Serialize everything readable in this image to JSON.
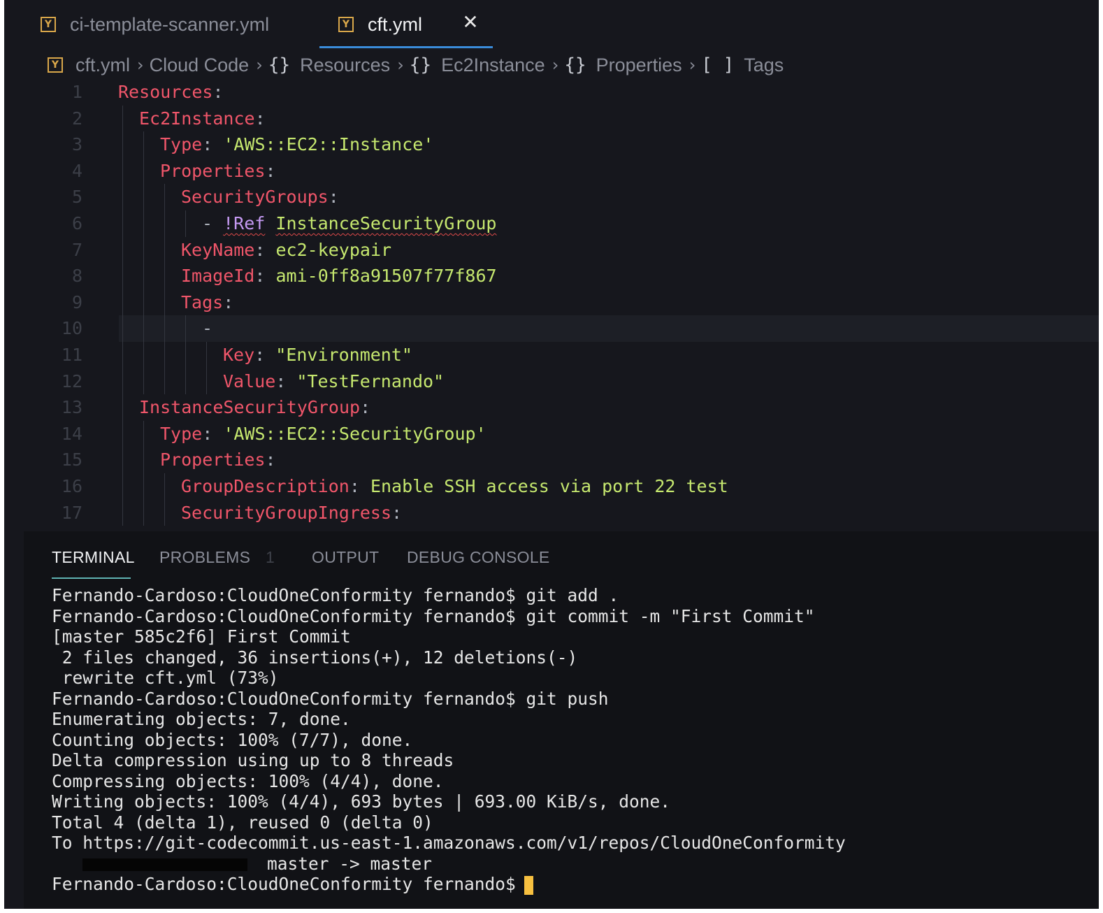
{
  "tabs": [
    {
      "icon": "yaml-file-icon",
      "label": "ci-template-scanner.yml",
      "active": false
    },
    {
      "icon": "yaml-file-icon",
      "label": "cft.yml",
      "active": true
    }
  ],
  "breadcrumb": {
    "items": [
      {
        "icon": "yaml-file-icon",
        "label": "cft.yml"
      },
      {
        "label": "Cloud Code"
      },
      {
        "icon": "{}",
        "label": "Resources"
      },
      {
        "icon": "{}",
        "label": "Ec2Instance"
      },
      {
        "icon": "{}",
        "label": "Properties"
      },
      {
        "icon": "[ ]",
        "label": "Tags"
      }
    ]
  },
  "editor": {
    "current_line": 10,
    "lines": [
      {
        "n": "1",
        "indent": 0,
        "key": "Resources",
        "colon": ":",
        "value": ""
      },
      {
        "n": "2",
        "indent": 1,
        "key": "Ec2Instance",
        "colon": ":",
        "value": ""
      },
      {
        "n": "3",
        "indent": 2,
        "key": "Type",
        "colon": ":",
        "value": "'AWS::EC2::Instance'"
      },
      {
        "n": "4",
        "indent": 2,
        "key": "Properties",
        "colon": ":",
        "value": ""
      },
      {
        "n": "5",
        "indent": 3,
        "key": "SecurityGroups",
        "colon": ":",
        "value": ""
      },
      {
        "n": "6",
        "indent": 4,
        "dash": "-",
        "tag": "!Ref",
        "value": "InstanceSecurityGroup"
      },
      {
        "n": "7",
        "indent": 3,
        "key": "KeyName",
        "colon": ":",
        "value": "ec2-keypair"
      },
      {
        "n": "8",
        "indent": 3,
        "key": "ImageId",
        "colon": ":",
        "value": "ami-0ff8a91507f77f867"
      },
      {
        "n": "9",
        "indent": 3,
        "key": "Tags",
        "colon": ":",
        "value": ""
      },
      {
        "n": "10",
        "indent": 4,
        "dash": "-"
      },
      {
        "n": "11",
        "indent": 5,
        "key": "Key",
        "colon": ":",
        "value": "\"Environment\""
      },
      {
        "n": "12",
        "indent": 5,
        "key": "Value",
        "colon": ":",
        "value": "\"TestFernando\""
      },
      {
        "n": "13",
        "indent": 1,
        "key": "InstanceSecurityGroup",
        "colon": ":",
        "value": ""
      },
      {
        "n": "14",
        "indent": 2,
        "key": "Type",
        "colon": ":",
        "value": "'AWS::EC2::SecurityGroup'"
      },
      {
        "n": "15",
        "indent": 2,
        "key": "Properties",
        "colon": ":",
        "value": ""
      },
      {
        "n": "16",
        "indent": 3,
        "key": "GroupDescription",
        "colon": ":",
        "value": "Enable SSH access via port 22 test"
      },
      {
        "n": "17",
        "indent": 3,
        "key": "SecurityGroupIngress",
        "colon": ":",
        "value": ""
      }
    ]
  },
  "panel": {
    "tabs": [
      {
        "label": "TERMINAL",
        "active": true
      },
      {
        "label": "PROBLEMS",
        "badge": "1"
      },
      {
        "label": "OUTPUT"
      },
      {
        "label": "DEBUG CONSOLE"
      }
    ]
  },
  "terminal": {
    "lines": [
      "Fernando-Cardoso:CloudOneConformity fernando$ git add .",
      "Fernando-Cardoso:CloudOneConformity fernando$ git commit -m \"First Commit\"",
      "[master 585c2f6] First Commit",
      " 2 files changed, 36 insertions(+), 12 deletions(-)",
      " rewrite cft.yml (73%)",
      "Fernando-Cardoso:CloudOneConformity fernando$ git push",
      "Enumerating objects: 7, done.",
      "Counting objects: 100% (7/7), done.",
      "Delta compression using up to 8 threads",
      "Compressing objects: 100% (4/4), done.",
      "Writing objects: 100% (4/4), 693 bytes | 693.00 KiB/s, done.",
      "Total 4 (delta 1), reused 0 (delta 0)",
      "To https://git-codecommit.us-east-1.amazonaws.com/v1/repos/CloudOneConformity"
    ],
    "push_ref": "master -> master",
    "prompt": "Fernando-Cardoso:CloudOneConformity fernando$"
  },
  "colors": {
    "background": "#16171d",
    "yaml_key": "#f0566a",
    "yaml_value": "#c6e86f",
    "yaml_tag": "#c59af3",
    "active_tab_underline": "#3a8bd9",
    "terminal_tab_underline": "#5fb3b3",
    "cursor": "#f7c040"
  }
}
